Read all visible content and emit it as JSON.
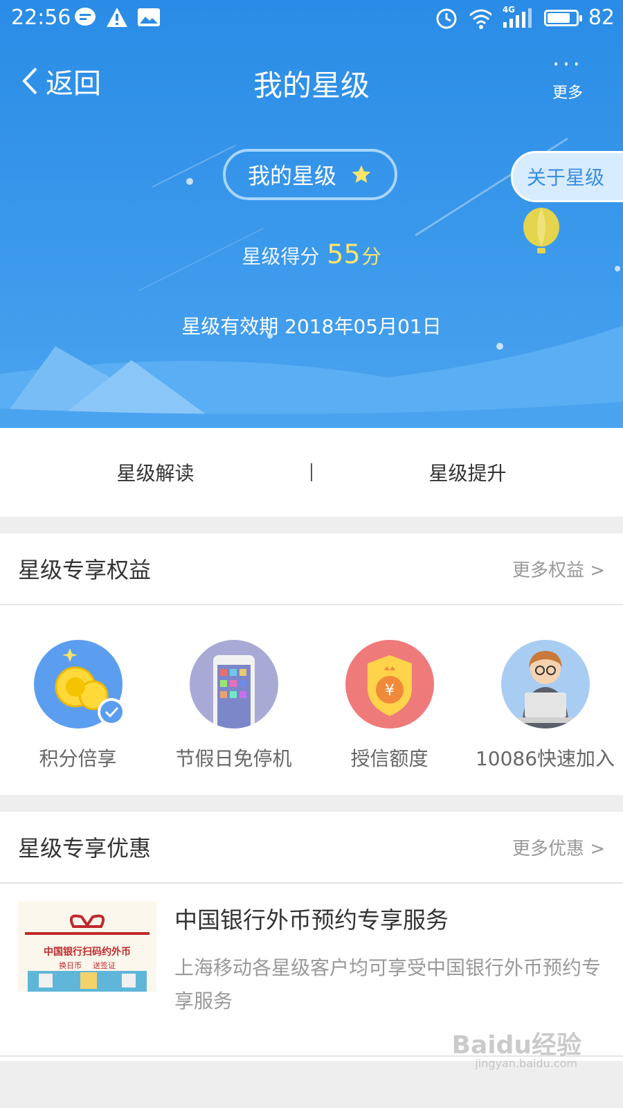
{
  "status": {
    "time": "22:56",
    "network": "4G",
    "battery": "82",
    "battery_level": 0.82
  },
  "nav": {
    "back_label": "返回",
    "title": "我的星级",
    "more_label": "更多"
  },
  "hero": {
    "pill_label": "我的星级",
    "about_label": "关于星级",
    "score_prefix": "星级得分",
    "score_value": "55",
    "score_unit": "分",
    "validity": "星级有效期 2018年05月01日"
  },
  "tabs": [
    {
      "label": "星级解读"
    },
    {
      "label": "星级提升"
    }
  ],
  "benefits_section": {
    "title": "星级专享权益",
    "more": "更多权益 >",
    "items": [
      {
        "label": "积分倍享",
        "icon": "coins-icon"
      },
      {
        "label": "节假日免停机",
        "icon": "phone-icon"
      },
      {
        "label": "授信额度",
        "icon": "shield-yuan-icon"
      },
      {
        "label": "10086快速加入",
        "icon": "customer-service-icon"
      }
    ]
  },
  "offers_section": {
    "title": "星级专享优惠",
    "more": "更多优惠 >",
    "items": [
      {
        "title": "中国银行外币预约专享服务",
        "desc": "上海移动各星级客户均可享受中国银行外币预约专享服务",
        "image_text": "中国银行扫码约外币",
        "image_sub1": "换日币",
        "image_sub2": "送签证"
      }
    ]
  },
  "watermark": {
    "main": "Baidu经验",
    "sub": "jingyan.baidu.com"
  }
}
